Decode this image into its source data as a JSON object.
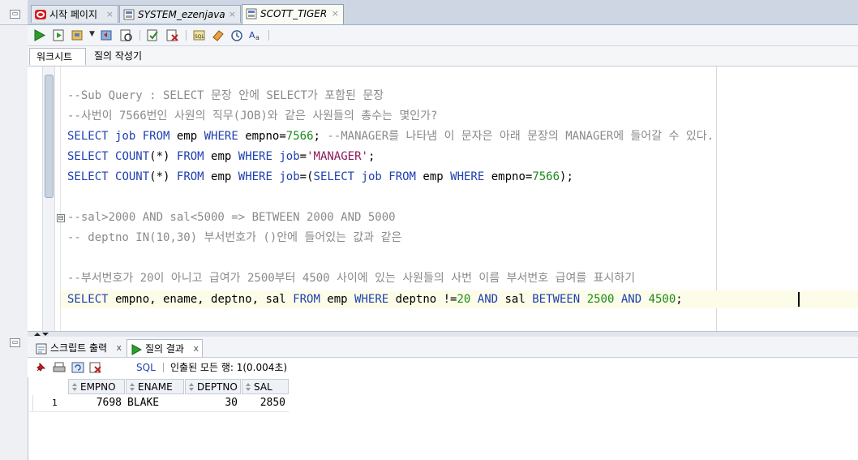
{
  "tabs": [
    {
      "label": "시작 페이지",
      "icon": "oracle-icon",
      "active": false,
      "italic": false
    },
    {
      "label": "SYSTEM_ezenjava",
      "icon": "sql-worksheet-icon",
      "active": false,
      "italic": true
    },
    {
      "label": "SCOTT_TIGER",
      "icon": "sql-worksheet-icon",
      "active": true,
      "italic": true
    }
  ],
  "tab_close_glyph": "×",
  "subtabs": {
    "worksheet": "워크시트",
    "query_builder": "질의 작성기"
  },
  "editor": {
    "lines": [
      {
        "kind": "comment",
        "text": "--Sub Query : SELECT 문장 안에 SELECT가 포함된 문장"
      },
      {
        "kind": "comment",
        "text": "--사번이 7566번인 사원의 직무(JOB)와 같은 사원들의 총수는 몇인가?"
      },
      {
        "kind": "sql1",
        "p1": "SELECT",
        "p2": " job ",
        "p3": "FROM",
        "p4": " emp ",
        "p5": "WHERE",
        "p6": " empno=",
        "p7": "7566",
        "p8": "; ",
        "p9": "--MANAGER를 나타냄 이 문자은 아래 문장의 MANAGER에 들어갈 수 있다."
      },
      {
        "kind": "sql2",
        "p1": "SELECT",
        "p2": " ",
        "p3": "COUNT",
        "p4": "(*) ",
        "p5": "FROM",
        "p6": " emp ",
        "p7": "WHERE",
        "p8": " ",
        "p9": "job",
        "p10": "=",
        "p11": "'MANAGER'",
        "p12": ";"
      },
      {
        "kind": "sql3",
        "p1": "SELECT",
        "p2": " ",
        "p3": "COUNT",
        "p4": "(*) ",
        "p5": "FROM",
        "p6": " emp ",
        "p7": "WHERE",
        "p8": " ",
        "p9": "job",
        "p10": "=(",
        "p11": "SELECT",
        "p12": " ",
        "p13": "job",
        "p14": " ",
        "p15": "FROM",
        "p16": " emp ",
        "p17": "WHERE",
        "p18": " empno=",
        "p19": "7566",
        "p20": ");"
      },
      {
        "kind": "comment",
        "text": "--sal>2000 AND sal<5000 => BETWEEN 2000 AND 5000"
      },
      {
        "kind": "comment",
        "text": "-- deptno IN(10,30) 부서번호가 ()안에 들어있는 값과 같은"
      },
      {
        "kind": "comment",
        "text": "--부서번호가 20이 아니고 급여가 2500부터 4500 사이에 있는 사원들의 사번 이름 부서번호 급여를 표시하기"
      },
      {
        "kind": "sql4",
        "p1": "SELECT",
        "p2": " empno, ename, deptno, sal ",
        "p3": "FROM",
        "p4": " emp ",
        "p5": "WHERE",
        "p6": " deptno !=",
        "p7": "20",
        "p8": " ",
        "p9": "AND",
        "p10": " sal ",
        "p11": "BETWEEN",
        "p12": " ",
        "p13": "2500",
        "p14": " ",
        "p15": "AND",
        "p16": " ",
        "p17": "4500",
        "p18": ";"
      }
    ],
    "fold_glyph": "⊟"
  },
  "results": {
    "tabs": [
      {
        "label": "스크립트 출력",
        "icon": "script-output-icon",
        "close": "x"
      },
      {
        "label": "질의 결과",
        "icon": "run-icon",
        "close": "x",
        "active": true
      }
    ],
    "toolbar": {
      "sql_label": "SQL",
      "status": "인출된 모든 행: 1(0.004초)"
    },
    "columns": [
      "EMPNO",
      "ENAME",
      "DEPTNO",
      "SAL"
    ],
    "rows": [
      {
        "row_num": "1",
        "EMPNO": "7698",
        "ENAME": "BLAKE",
        "DEPTNO": "30",
        "SAL": "2850"
      }
    ]
  },
  "colors": {
    "keyword": "#1e3fb0",
    "comment": "#8a8a8a",
    "number": "#1a8a1a",
    "string": "#8a1a5a"
  }
}
